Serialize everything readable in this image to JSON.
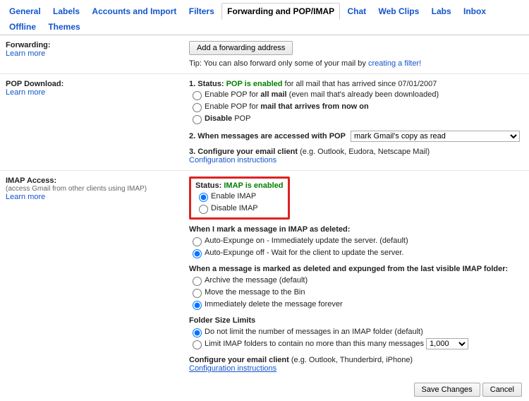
{
  "tabs": [
    "General",
    "Labels",
    "Accounts and Import",
    "Filters",
    "Forwarding and POP/IMAP",
    "Chat",
    "Web Clips",
    "Labs",
    "Inbox",
    "Offline",
    "Themes"
  ],
  "active_tab_index": 4,
  "forwarding": {
    "title": "Forwarding:",
    "learn_more": "Learn more",
    "add_btn": "Add a forwarding address",
    "tip_prefix": "Tip: You can also forward only some of your mail by ",
    "tip_link": "creating a filter!"
  },
  "pop": {
    "title": "POP Download:",
    "learn_more": "Learn more",
    "status_label": "1. Status:",
    "status_value": "POP is enabled",
    "status_tail": " for all mail that has arrived since 07/01/2007",
    "opt_allmail_pre": "Enable POP for ",
    "opt_allmail_bold": "all mail",
    "opt_allmail_tail": " (even mail that's already been downloaded)",
    "opt_nowon_pre": "Enable POP for ",
    "opt_nowon_bold": "mail that arrives from now on",
    "opt_disable_pre": "Disable",
    "opt_disable_tail": " POP",
    "access_label": "2. When messages are accessed with POP",
    "access_select": "mark Gmail's copy as read",
    "configure_label": "3. Configure your email client",
    "configure_tail": " (e.g. Outlook, Eudora, Netscape Mail)",
    "config_link": "Configuration instructions"
  },
  "imap": {
    "title": "IMAP Access:",
    "subtitle": "(access Gmail from other clients using IMAP)",
    "learn_more": "Learn more",
    "status_label": "Status:",
    "status_value": "IMAP is enabled",
    "enable": "Enable IMAP",
    "disable": "Disable IMAP",
    "mark_deleted_title": "When I mark a message in IMAP as deleted:",
    "expunge_on": "Auto-Expunge on - Immediately update the server. (default)",
    "expunge_off": "Auto-Expunge off - Wait for the client to update the server.",
    "expunged_title": "When a message is marked as deleted and expunged from the last visible IMAP folder:",
    "archive": "Archive the message (default)",
    "move_bin": "Move the message to the Bin",
    "delete_forever": "Immediately delete the message forever",
    "folder_title": "Folder Size Limits",
    "nolimit": "Do not limit the number of messages in an IMAP folder (default)",
    "limit_pre": "Limit IMAP folders to contain no more than this many messages ",
    "limit_select": "1,000",
    "configure_label": "Configure your email client",
    "configure_tail": " (e.g. Outlook, Thunderbird, iPhone)",
    "config_link": "Configuration instructions"
  },
  "footer": {
    "save": "Save Changes",
    "cancel": "Cancel"
  }
}
